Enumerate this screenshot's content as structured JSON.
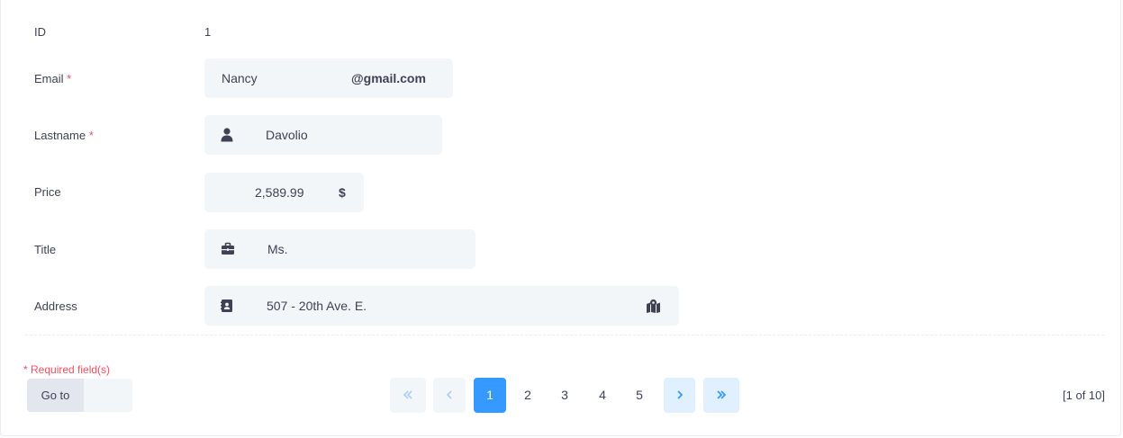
{
  "form": {
    "id": {
      "label": "ID",
      "value": "1"
    },
    "email": {
      "label": "Email",
      "required_mark": "*",
      "value": "Nancy",
      "suffix": "@gmail.com"
    },
    "lastname": {
      "label": "Lastname",
      "required_mark": "*",
      "value": "Davolio",
      "icon": "user-icon"
    },
    "price": {
      "label": "Price",
      "value": "2,589.99",
      "suffix": "$"
    },
    "title": {
      "label": "Title",
      "value": "Ms.",
      "icon": "briefcase-icon"
    },
    "address": {
      "label": "Address",
      "value": "507 - 20th Ave. E.",
      "icon": "contact-card-icon",
      "trailing_icon": "map-marker-icon"
    }
  },
  "footer": {
    "required_note": "* Required field(s)",
    "goto_label": "Go to",
    "goto_value": ""
  },
  "pager": {
    "pages": [
      "1",
      "2",
      "3",
      "4",
      "5"
    ],
    "current_page": 1,
    "info": "[1 of 10]"
  },
  "colors": {
    "accent": "#3699ff",
    "required": "#f64e60",
    "field_bg": "#f3f6f9"
  }
}
